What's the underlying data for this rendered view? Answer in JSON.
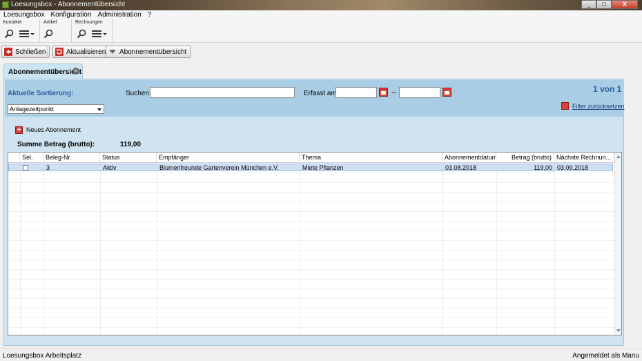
{
  "window": {
    "title": "Loesungsbox - Abonnementübersicht",
    "controls": [
      "_",
      "□",
      "X"
    ]
  },
  "menu": [
    "Loesungsbox",
    "Konfiguration",
    "Administration",
    "?"
  ],
  "toolgroups": [
    {
      "label": "Kontakte"
    },
    {
      "label": "Artikel"
    },
    {
      "label": "Rechnungen"
    }
  ],
  "actions": {
    "close": "Schließen",
    "refresh": "Aktualisieren",
    "overview": "Abonnementübersicht"
  },
  "tab": {
    "label": "Abonnementübersicht"
  },
  "filter": {
    "sort_label": "Aktuelle Sortierung:",
    "sort_value": "Anlagezeitpunkt",
    "search_label": "Suchen:",
    "search_value": "",
    "erfasst_label": "Erfasst am:",
    "date_from": "",
    "date_to": "",
    "dash": "–",
    "pagination": "1 von 1",
    "reset": "Filter zurücksetzen"
  },
  "new_subscription": "Neues Abonnement",
  "sum": {
    "label": "Summe Betrag (brutto):",
    "value": "119,00"
  },
  "table": {
    "columns": [
      "Sel.",
      "Beleg-Nr.",
      "Status",
      "Empfänger",
      "Thema",
      "Abonnementdatum",
      "Betrag (brutto)",
      "Nächste Rechnun..."
    ],
    "rows": [
      {
        "selected": false,
        "beleg_nr": "3",
        "status": "Aktiv",
        "empfaenger": "Blumenfreunde Gartenverein München e.V.",
        "thema": "Miete Pflanzen",
        "abonnementdatum": "03.08.2018",
        "betrag": "119,00",
        "naechste": "03.09.2018"
      }
    ]
  },
  "status": {
    "left": "Loesungsbox Arbeitsplatz",
    "right": "Angemeldet als Manu"
  },
  "colors": {
    "accent": "#2c5fa2",
    "panel": "#cfe3f0",
    "filter": "#a9cde4",
    "icon_red": "#d9423a"
  }
}
